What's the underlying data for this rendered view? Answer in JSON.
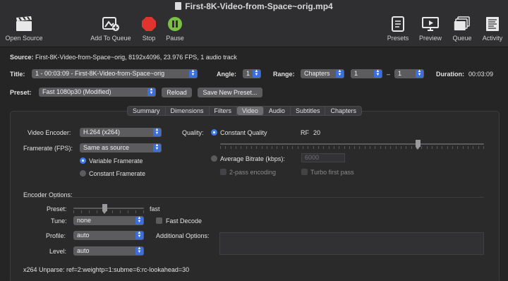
{
  "window": {
    "title": "First-8K-Video-from-Space~orig.mp4"
  },
  "toolbar": {
    "open_source": "Open Source",
    "add_to_queue": "Add To Queue",
    "stop": "Stop",
    "pause": "Pause",
    "presets": "Presets",
    "preview": "Preview",
    "queue": "Queue",
    "activity": "Activity"
  },
  "source": {
    "label": "Source:",
    "value": "First-8K-Video-from-Space~orig, 8192x4096, 23.976 FPS, 1 audio track"
  },
  "title_row": {
    "title_label": "Title:",
    "title_value": "1 - 00:03:09 - First-8K-Video-from-Space~orig",
    "angle_label": "Angle:",
    "angle_value": "1",
    "range_label": "Range:",
    "range_type": "Chapters",
    "range_start": "1",
    "range_dash": "–",
    "range_end": "1",
    "duration_label": "Duration:",
    "duration_value": "00:03:09"
  },
  "preset_row": {
    "label": "Preset:",
    "value": "Fast 1080p30 (Modified)",
    "reload": "Reload",
    "save_new": "Save New Preset..."
  },
  "tabs": [
    "Summary",
    "Dimensions",
    "Filters",
    "Video",
    "Audio",
    "Subtitles",
    "Chapters"
  ],
  "active_tab": "Video",
  "video": {
    "encoder_label": "Video Encoder:",
    "encoder_value": "H.264 (x264)",
    "framerate_label": "Framerate (FPS):",
    "framerate_value": "Same as source",
    "variable_framerate": "Variable Framerate",
    "constant_framerate": "Constant Framerate",
    "quality_label": "Quality:",
    "constant_quality": "Constant Quality",
    "rf_label": "RF",
    "rf_value": "20",
    "rf_slider_fraction": 0.75,
    "average_bitrate": "Average Bitrate (kbps):",
    "bitrate_placeholder": "6000",
    "two_pass": "2-pass encoding",
    "turbo": "Turbo first pass"
  },
  "encoder_options": {
    "header": "Encoder Options:",
    "preset_label": "Preset:",
    "preset_value": "fast",
    "preset_slider_fraction": 0.44,
    "tune_label": "Tune:",
    "tune_value": "none",
    "fast_decode": "Fast Decode",
    "profile_label": "Profile:",
    "profile_value": "auto",
    "additional_label": "Additional Options:",
    "level_label": "Level:",
    "level_value": "auto",
    "unparse": "x264 Unparse: ref=2:weightp=1:subme=6:rc-lookahead=30"
  },
  "colors": {
    "accent": "#3d7bf0",
    "stop": "#e0342f",
    "pause": "#7ac143"
  }
}
